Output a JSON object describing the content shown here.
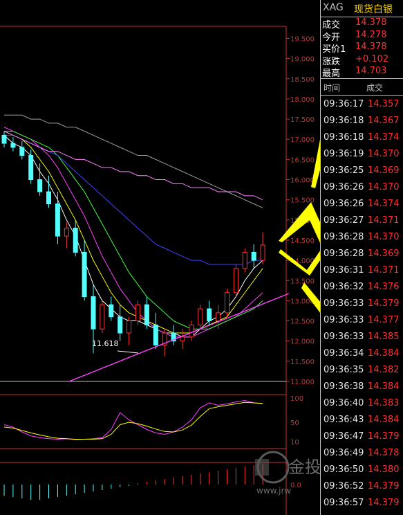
{
  "header": {
    "symbol": "XAG",
    "name": "现货白银"
  },
  "quote": [
    {
      "label": "成交",
      "value": "14.378"
    },
    {
      "label": "今开",
      "value": "14.278"
    },
    {
      "label": "买价1",
      "value": "14.378"
    },
    {
      "label": "涨跌",
      "value": "+0.102"
    },
    {
      "label": "最高",
      "value": "14.703"
    }
  ],
  "ticks_header": {
    "time": "时间",
    "price": "成交"
  },
  "ticks": [
    {
      "time": "09:36:17",
      "price": "14.357"
    },
    {
      "time": "09:36:18",
      "price": "14.367"
    },
    {
      "time": "09:36:18",
      "price": "14.374"
    },
    {
      "time": "09:36:19",
      "price": "14.370"
    },
    {
      "time": "09:36:25",
      "price": "14.369"
    },
    {
      "time": "09:36:26",
      "price": "14.370"
    },
    {
      "time": "09:36:26",
      "price": "14.374"
    },
    {
      "time": "09:36:27",
      "price": "14.371"
    },
    {
      "time": "09:36:28",
      "price": "14.370"
    },
    {
      "time": "09:36:28",
      "price": "14.369"
    },
    {
      "time": "09:36:31",
      "price": "14.371"
    },
    {
      "time": "09:36:32",
      "price": "14.376"
    },
    {
      "time": "09:36:33",
      "price": "14.379"
    },
    {
      "time": "09:36:33",
      "price": "14.377"
    },
    {
      "time": "09:36:33",
      "price": "14.385"
    },
    {
      "time": "09:36:34",
      "price": "14.384"
    },
    {
      "time": "09:36:35",
      "price": "14.382"
    },
    {
      "time": "09:36:38",
      "price": "14.384"
    },
    {
      "time": "09:36:40",
      "price": "14.383"
    },
    {
      "time": "09:36:43",
      "price": "14.384"
    },
    {
      "time": "09:36:47",
      "price": "14.379"
    },
    {
      "time": "09:36:49",
      "price": "14.378"
    },
    {
      "time": "09:36:50",
      "price": "14.380"
    },
    {
      "time": "09:36:52",
      "price": "14.379"
    },
    {
      "time": "09:36:57",
      "price": "14.379"
    }
  ],
  "colors": {
    "up": "#ff3232",
    "down": "#54ffff",
    "axis": "#c83232",
    "accent": "#ffff00"
  },
  "watermark": {
    "brand": "金投网",
    "url": "www.jrw"
  },
  "chart_data": {
    "type": "candlestick",
    "price_axis": {
      "ticks": [
        "19.500",
        "19.000",
        "18.500",
        "18.000",
        "17.500",
        "17.000",
        "16.500",
        "16.000",
        "15.500",
        "15.000",
        "14.500",
        "14.000",
        "13.500",
        "13.000",
        "12.500",
        "12.000",
        "11.500",
        "11.000"
      ],
      "range": [
        11.0,
        19.8
      ]
    },
    "low_annotation": "11.618",
    "candles": [
      [
        17.1,
        17.2,
        16.8,
        16.9
      ],
      [
        16.9,
        17.05,
        16.7,
        16.8
      ],
      [
        16.8,
        16.95,
        16.5,
        16.6
      ],
      [
        16.6,
        16.75,
        15.9,
        16.0
      ],
      [
        16.0,
        16.4,
        15.6,
        15.7
      ],
      [
        15.7,
        16.1,
        15.3,
        15.4
      ],
      [
        15.4,
        15.7,
        14.4,
        14.6
      ],
      [
        14.6,
        14.95,
        14.3,
        14.8
      ],
      [
        14.8,
        15.0,
        14.1,
        14.2
      ],
      [
        14.2,
        14.5,
        13.0,
        13.1
      ],
      [
        13.1,
        13.4,
        11.7,
        12.3
      ],
      [
        12.3,
        13.0,
        12.2,
        12.9
      ],
      [
        12.9,
        13.1,
        12.5,
        12.6
      ],
      [
        12.6,
        12.9,
        12.0,
        12.2
      ],
      [
        12.2,
        12.6,
        11.9,
        12.5
      ],
      [
        12.5,
        13.0,
        12.4,
        12.9
      ],
      [
        12.9,
        13.1,
        12.3,
        12.4
      ],
      [
        12.4,
        12.7,
        11.8,
        11.9
      ],
      [
        11.9,
        12.3,
        11.62,
        12.2
      ],
      [
        12.2,
        12.4,
        11.9,
        12.0
      ],
      [
        12.0,
        12.3,
        11.8,
        12.1
      ],
      [
        12.1,
        12.5,
        12.0,
        12.4
      ],
      [
        12.4,
        12.9,
        12.3,
        12.8
      ],
      [
        12.8,
        13.0,
        12.4,
        12.5
      ],
      [
        12.5,
        12.9,
        12.3,
        12.7
      ],
      [
        12.7,
        13.3,
        12.6,
        13.2
      ],
      [
        13.2,
        13.9,
        13.1,
        13.8
      ],
      [
        13.8,
        14.3,
        13.7,
        14.2
      ],
      [
        14.2,
        14.4,
        13.8,
        14.0
      ],
      [
        14.0,
        14.7,
        13.9,
        14.38
      ]
    ],
    "ma_series": [
      {
        "color": "#ffffff",
        "values": [
          17.1,
          16.9,
          16.8,
          16.6,
          16.2,
          15.9,
          15.5,
          15.0,
          14.6,
          14.0,
          13.4,
          13.0,
          12.8,
          12.6,
          12.5,
          12.5,
          12.4,
          12.3,
          12.2,
          12.2,
          12.1,
          12.1,
          12.3,
          12.5,
          12.6,
          12.8,
          13.1,
          13.5,
          13.8,
          14.0
        ]
      },
      {
        "color": "#ffff00",
        "values": [
          17.2,
          17.1,
          17.0,
          16.8,
          16.5,
          16.2,
          15.8,
          15.4,
          15.0,
          14.5,
          14.0,
          13.6,
          13.2,
          12.9,
          12.7,
          12.6,
          12.5,
          12.4,
          12.3,
          12.2,
          12.2,
          12.2,
          12.3,
          12.4,
          12.5,
          12.6,
          12.9,
          13.2,
          13.5,
          13.8
        ]
      },
      {
        "color": "#ff40ff",
        "values": [
          17.3,
          17.2,
          17.1,
          17.0,
          16.8,
          16.6,
          16.3,
          15.9,
          15.5,
          15.1,
          14.6,
          14.1,
          13.7,
          13.3,
          13.0,
          12.7,
          12.5,
          12.3,
          12.2,
          12.1,
          12.1,
          12.1,
          12.2,
          12.3,
          12.4,
          12.5,
          12.6,
          12.8,
          13.0,
          13.2
        ]
      },
      {
        "color": "#40ff40",
        "values": [
          17.2,
          17.2,
          17.1,
          17.0,
          16.9,
          16.8,
          16.6,
          16.3,
          16.0,
          15.7,
          15.3,
          14.9,
          14.5,
          14.1,
          13.7,
          13.4,
          13.1,
          12.9,
          12.7,
          12.5,
          12.4,
          12.3,
          12.3,
          12.3,
          12.4,
          12.5,
          12.6,
          12.7,
          12.8,
          13.0
        ]
      },
      {
        "color": "#4040ff",
        "values": [
          17.1,
          17.1,
          17.0,
          16.9,
          16.8,
          16.7,
          16.6,
          16.4,
          16.2,
          16.0,
          15.8,
          15.6,
          15.4,
          15.2,
          15.0,
          14.8,
          14.6,
          14.4,
          14.3,
          14.2,
          14.1,
          14.0,
          14.0,
          13.9,
          13.9,
          13.9,
          13.9,
          13.9,
          14.0,
          14.0
        ]
      },
      {
        "color": "#ff80ff",
        "values": [
          17.2,
          17.1,
          17.0,
          16.9,
          16.8,
          16.7,
          16.7,
          16.6,
          16.5,
          16.5,
          16.4,
          16.3,
          16.3,
          16.2,
          16.2,
          16.1,
          16.1,
          16.0,
          16.0,
          15.9,
          15.9,
          15.8,
          15.8,
          15.8,
          15.7,
          15.7,
          15.7,
          15.6,
          15.6,
          15.5
        ]
      },
      {
        "color": "#a0a0a0",
        "values": [
          17.6,
          17.6,
          17.6,
          17.5,
          17.5,
          17.4,
          17.4,
          17.3,
          17.3,
          17.2,
          17.1,
          17.0,
          16.9,
          16.8,
          16.7,
          16.6,
          16.6,
          16.5,
          16.4,
          16.3,
          16.2,
          16.1,
          16.0,
          15.9,
          15.8,
          15.7,
          15.6,
          15.5,
          15.4,
          15.3
        ]
      }
    ],
    "oscillator": {
      "ticks": [
        "100",
        "50",
        "10"
      ],
      "k": [
        45,
        40,
        30,
        22,
        18,
        16,
        15,
        16,
        14,
        15,
        16,
        18,
        35,
        70,
        55,
        45,
        35,
        28,
        25,
        30,
        40,
        55,
        80,
        90,
        85,
        88,
        92,
        95,
        90,
        88
      ],
      "d": [
        40,
        38,
        33,
        28,
        24,
        20,
        17,
        16,
        15,
        15,
        15,
        16,
        25,
        45,
        50,
        47,
        42,
        36,
        31,
        30,
        34,
        44,
        62,
        78,
        82,
        85,
        88,
        91,
        90,
        89
      ]
    },
    "macd": {
      "tick": "0.0",
      "hist": [
        -0.8,
        -0.9,
        -1.0,
        -1.1,
        -1.1,
        -1.0,
        -0.9,
        -0.8,
        -0.7,
        -0.6,
        -0.5,
        -0.4,
        -0.3,
        -0.2,
        -0.1,
        0.1,
        0.2,
        0.3,
        0.4,
        0.5,
        0.6,
        0.7,
        0.8,
        0.9,
        1.0,
        1.1,
        1.2,
        1.3,
        1.4,
        1.5
      ]
    }
  }
}
